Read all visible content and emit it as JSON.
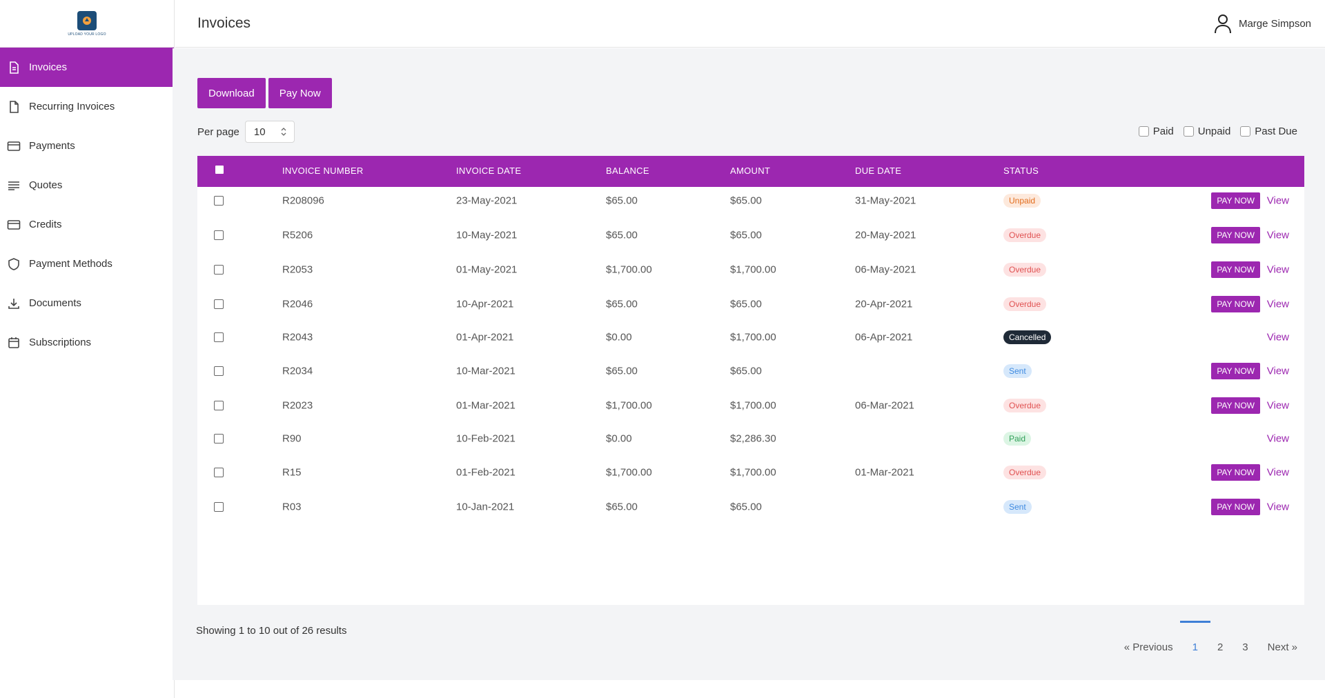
{
  "logo": {
    "text": "UPLOAD YOUR LOGO"
  },
  "sidebar": {
    "items": [
      {
        "label": "Invoices",
        "icon": "document-icon",
        "active": true
      },
      {
        "label": "Recurring Invoices",
        "icon": "file-icon"
      },
      {
        "label": "Payments",
        "icon": "card-icon"
      },
      {
        "label": "Quotes",
        "icon": "lines-icon"
      },
      {
        "label": "Credits",
        "icon": "card-icon"
      },
      {
        "label": "Payment Methods",
        "icon": "shield-icon"
      },
      {
        "label": "Documents",
        "icon": "download-icon"
      },
      {
        "label": "Subscriptions",
        "icon": "calendar-icon"
      }
    ]
  },
  "header": {
    "title": "Invoices",
    "user_name": "Marge Simpson"
  },
  "toolbar": {
    "download_label": "Download",
    "pay_now_label": "Pay Now"
  },
  "perpage": {
    "label": "Per page",
    "value": "10"
  },
  "filters": {
    "paid": "Paid",
    "unpaid": "Unpaid",
    "past_due": "Past Due"
  },
  "table": {
    "headers": [
      "INVOICE NUMBER",
      "INVOICE DATE",
      "BALANCE",
      "AMOUNT",
      "DUE DATE",
      "STATUS"
    ],
    "pay_now_label": "PAY NOW",
    "view_label": "View",
    "rows": [
      {
        "number": "R208096",
        "date": "23-May-2021",
        "balance": "$65.00",
        "amount": "$65.00",
        "due": "31-May-2021",
        "status": "Unpaid",
        "status_type": "unpaid",
        "pay": true
      },
      {
        "number": "R5206",
        "date": "10-May-2021",
        "balance": "$65.00",
        "amount": "$65.00",
        "due": "20-May-2021",
        "status": "Overdue",
        "status_type": "overdue",
        "pay": true
      },
      {
        "number": "R2053",
        "date": "01-May-2021",
        "balance": "$1,700.00",
        "amount": "$1,700.00",
        "due": "06-May-2021",
        "status": "Overdue",
        "status_type": "overdue",
        "pay": true
      },
      {
        "number": "R2046",
        "date": "10-Apr-2021",
        "balance": "$65.00",
        "amount": "$65.00",
        "due": "20-Apr-2021",
        "status": "Overdue",
        "status_type": "overdue",
        "pay": true
      },
      {
        "number": "R2043",
        "date": "01-Apr-2021",
        "balance": "$0.00",
        "amount": "$1,700.00",
        "due": "06-Apr-2021",
        "status": "Cancelled",
        "status_type": "cancelled",
        "pay": false
      },
      {
        "number": "R2034",
        "date": "10-Mar-2021",
        "balance": "$65.00",
        "amount": "$65.00",
        "due": "",
        "status": "Sent",
        "status_type": "sent",
        "pay": true
      },
      {
        "number": "R2023",
        "date": "01-Mar-2021",
        "balance": "$1,700.00",
        "amount": "$1,700.00",
        "due": "06-Mar-2021",
        "status": "Overdue",
        "status_type": "overdue",
        "pay": true
      },
      {
        "number": "R90",
        "date": "10-Feb-2021",
        "balance": "$0.00",
        "amount": "$2,286.30",
        "due": "",
        "status": "Paid",
        "status_type": "paid",
        "pay": false
      },
      {
        "number": "R15",
        "date": "01-Feb-2021",
        "balance": "$1,700.00",
        "amount": "$1,700.00",
        "due": "01-Mar-2021",
        "status": "Overdue",
        "status_type": "overdue",
        "pay": true
      },
      {
        "number": "R03",
        "date": "10-Jan-2021",
        "balance": "$65.00",
        "amount": "$65.00",
        "due": "",
        "status": "Sent",
        "status_type": "sent",
        "pay": true
      }
    ]
  },
  "footer": {
    "showing": "Showing 1 to 10 out of 26 results",
    "previous": "« Previous",
    "pages": [
      "1",
      "2",
      "3"
    ],
    "current_page": "1",
    "next": "Next »"
  },
  "colors": {
    "accent": "#9c27b0",
    "link_active": "#3e7fd6"
  }
}
